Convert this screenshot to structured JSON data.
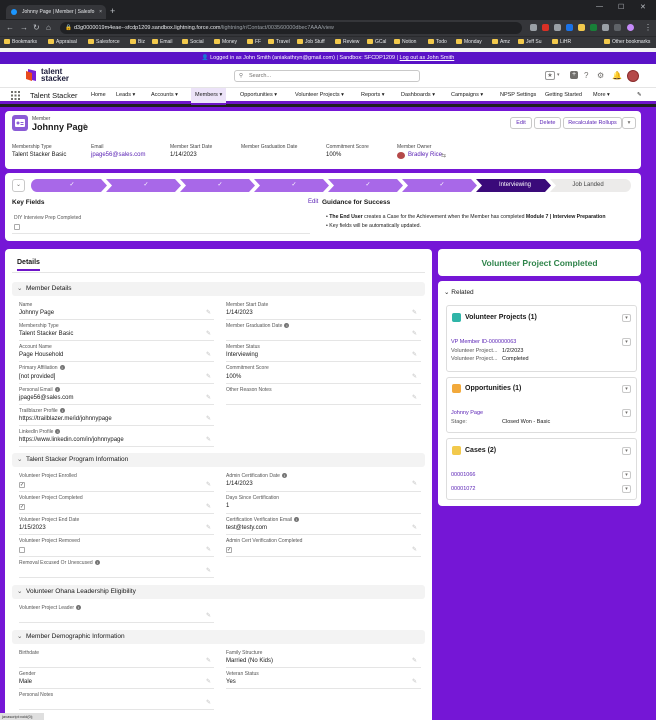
{
  "browser": {
    "tab_title": "Johnny Page | Member | Salesfo",
    "url_host": "d3g0000019m4eae--sfcdp1209.sandbox.lightning.force.com",
    "url_path": "/lightning/r/Contact/003560000dbec7AAA/view",
    "bookmarks": [
      "Bookmarks",
      "Appraisal",
      "Salesforce",
      "Biz",
      "Email",
      "Social",
      "Money",
      "FF",
      "Travel",
      "Job Stuff",
      "Review",
      "GCal",
      "Notion",
      "Todo",
      "Monday",
      "Amz",
      "Jeff Su",
      "LiHR",
      "Other bookmarks"
    ]
  },
  "sandbox_bar": {
    "text": "Logged in as John Smith (aniakathryn@gmail.com) | Sandbox: SFCDP1209 |",
    "logout": "Log out as John Smith"
  },
  "header": {
    "logo_line1": "talent",
    "logo_line2": "stacker",
    "search_placeholder": "Search..."
  },
  "nav": {
    "app_name": "Talent Stacker",
    "items": [
      "Home",
      "Leads",
      "Accounts",
      "Members",
      "Opportunities",
      "Volunteer Projects",
      "Reports",
      "Dashboards",
      "Campaigns",
      "NPSP Settings",
      "Getting Started",
      "More"
    ]
  },
  "record": {
    "object_label": "Member",
    "name": "Johnny Page",
    "buttons": [
      "Edit",
      "Delete",
      "Recalculate Rollups"
    ],
    "highlights": [
      {
        "label": "Membership Type",
        "value": "Talent Stacker Basic"
      },
      {
        "label": "Email",
        "value": "jpage56@sales.com"
      },
      {
        "label": "Member Start Date",
        "value": "1/14/2023"
      },
      {
        "label": "Member Graduation Date",
        "value": ""
      },
      {
        "label": "Commitment Score",
        "value": "100%"
      },
      {
        "label": "Member Owner",
        "value": "Bradley Rice"
      }
    ]
  },
  "path": {
    "current": "Interviewing",
    "next": "Job Landed",
    "check": "✓"
  },
  "key_fields": {
    "title": "Key Fields",
    "edit": "Edit",
    "field": "DIY Interview Prep Completed",
    "guidance_title": "Guidance for Success",
    "bullet1_a": "The End User",
    "bullet1_b": " creates a Case for the Achievement when the Member has completed ",
    "bullet1_c": "Module 7 | Interview Preparation",
    "bullet2": "Key fields will be automatically updated."
  },
  "details": {
    "tab": "Details",
    "member_details": "Member Details",
    "name_l": "Name",
    "name_v": "Johnny Page",
    "start_l": "Member Start Date",
    "start_v": "1/14/2023",
    "mtype_l": "Membership Type",
    "mtype_v": "Talent Stacker Basic",
    "grad_l": "Member Graduation Date",
    "acct_l": "Account Name",
    "acct_v": "Page Household",
    "status_l": "Member Status",
    "status_v": "Interviewing",
    "aff_l": "Primary Affiliation",
    "aff_v": "[not provided]",
    "cscore_l": "Commitment Score",
    "cscore_v": "100%",
    "pemail_l": "Personal Email",
    "pemail_v": "jpage56@sales.com",
    "other_l": "Other Reason Notes",
    "tb_l": "Trailblazer Profile",
    "tb_v": "https://trailblazer.me/id/johnnypage",
    "li_l": "LinkedIn Profile",
    "li_v": "https://www.linkedin.com/in/johnnypage",
    "program": "Talent Stacker Program Information",
    "vpe_l": "Volunteer Project Enrolled",
    "acd_l": "Admin Certification Date",
    "acd_v": "1/14/2023",
    "vpc_l": "Volunteer Project Completed",
    "dsc_l": "Days Since Certification",
    "dsc_v": "1",
    "vped_l": "Volunteer Project End Date",
    "vped_v": "1/15/2023",
    "cve_l": "Certification Verification Email",
    "cve_v": "test@testy.com",
    "vpr_l": "Volunteer Project Removed",
    "acvc_l": "Admin Cert Verification Completed",
    "reu_l": "Removal Excused Or Unexcused",
    "ohana": "Volunteer Ohana Leadership Eligibility",
    "vpl_l": "Volunteer Project Leader",
    "demo": "Member Demographic Information",
    "bd_l": "Birthdate",
    "fs_l": "Family Structure",
    "fs_v": "Married (No Kids)",
    "gender_l": "Gender",
    "gender_v": "Male",
    "vet_l": "Veteran Status",
    "vet_v": "Yes",
    "pn_l": "Personal Notes"
  },
  "right": {
    "banner": "Volunteer Project Completed",
    "related": "Related",
    "vp_title": "Volunteer Projects (1)",
    "vp_id": "VP Member ID-000000063",
    "vp_r1_l": "Volunteer Project...",
    "vp_r1_v": "1/2/2023",
    "vp_r2_l": "Volunteer Project...",
    "vp_r2_v": "Completed",
    "opp_title": "Opportunities (1)",
    "opp_name": "Johnny Page",
    "opp_stage_l": "Stage:",
    "opp_stage_v": "Closed Won - Basic",
    "cases_title": "Cases (2)",
    "case1": "00001066",
    "case2": "00001072"
  },
  "status_text": "javascript:void(0);",
  "colors": {
    "brand": "#7516d6",
    "path_done": "#a868e8",
    "path_current": "#3a0a7a",
    "success": "#2e844a",
    "link": "#5a22b5"
  }
}
